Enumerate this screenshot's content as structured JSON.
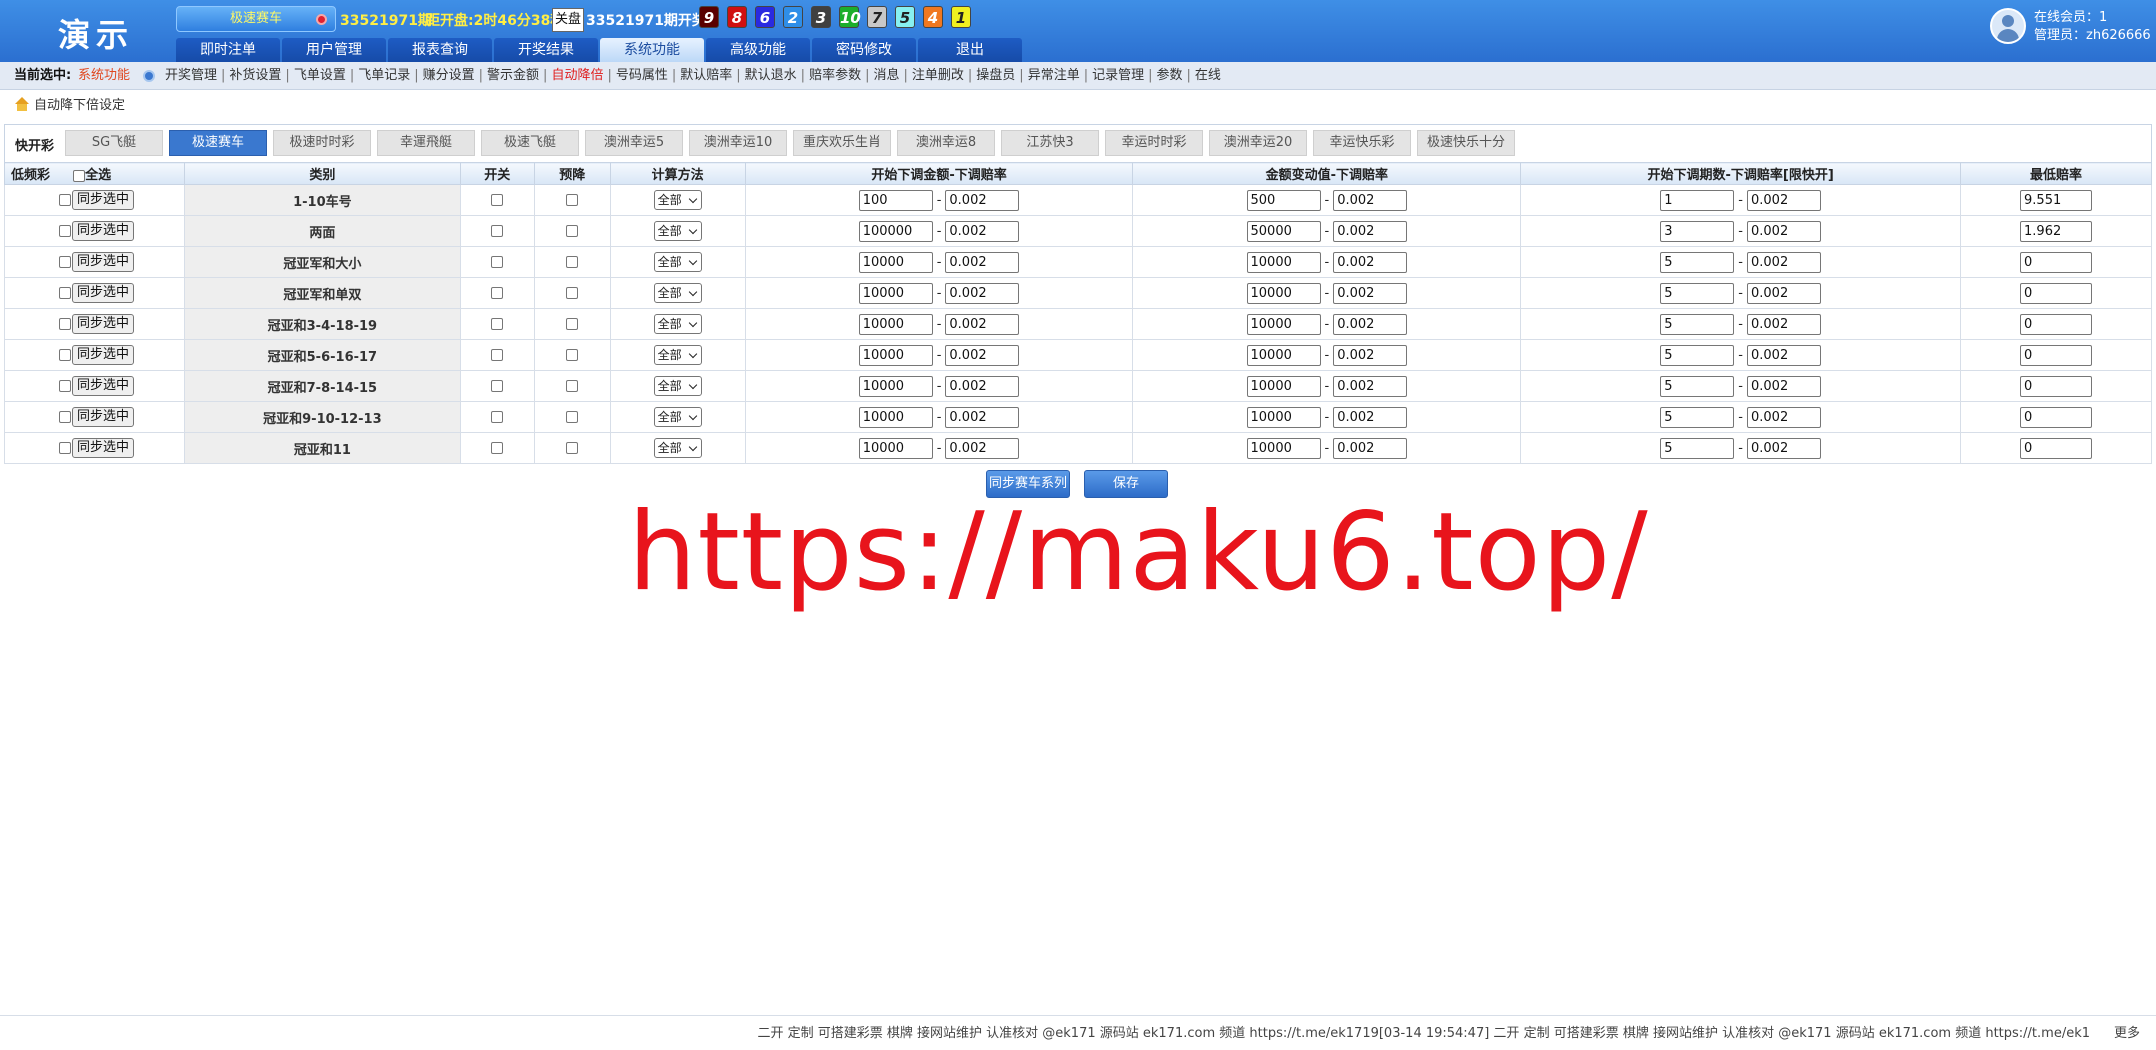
{
  "header": {
    "logo": "演示",
    "game_name": "极速赛车",
    "period_current": "33521971期",
    "countdown_label": "距开盘:2时46分38秒",
    "close_button": "关盘",
    "period_result": "33521971期开奖:",
    "balls": [
      {
        "n": "9",
        "color": "#5a0000"
      },
      {
        "n": "8",
        "color": "#d01010"
      },
      {
        "n": "6",
        "color": "#2a2ae0"
      },
      {
        "n": "2",
        "color": "#2f8ee8"
      },
      {
        "n": "3",
        "color": "#404040"
      },
      {
        "n": "10",
        "color": "#1cae2c"
      },
      {
        "n": "7",
        "color": "#c8c8c8"
      },
      {
        "n": "5",
        "color": "#88f0f0"
      },
      {
        "n": "4",
        "color": "#f07820"
      },
      {
        "n": "1",
        "color": "#f0f020"
      }
    ],
    "nav": [
      "即时注单",
      "用户管理",
      "报表查询",
      "开奖结果",
      "系统功能",
      "高级功能",
      "密码修改",
      "退出"
    ],
    "nav_active": 4,
    "online_label": "在线会员：1",
    "admin_label": "管理员：zh626666"
  },
  "submenu": {
    "current_label": "当前选中:",
    "current_value": "系统功能",
    "links": [
      {
        "t": "开奖管理",
        "hot": false
      },
      {
        "t": "补货设置",
        "hot": false
      },
      {
        "t": "飞单设置",
        "hot": false
      },
      {
        "t": "飞单记录",
        "hot": false
      },
      {
        "t": "赚分设置",
        "hot": false
      },
      {
        "t": "警示金额",
        "hot": false
      },
      {
        "t": "自动降倍",
        "hot": true
      },
      {
        "t": "号码属性",
        "hot": false
      },
      {
        "t": "默认赔率",
        "hot": false
      },
      {
        "t": "默认退水",
        "hot": false
      },
      {
        "t": "赔率参数",
        "hot": false
      },
      {
        "t": "消息",
        "hot": false
      },
      {
        "t": "注单删改",
        "hot": false
      },
      {
        "t": "操盘员",
        "hot": false
      },
      {
        "t": "异常注单",
        "hot": false
      },
      {
        "t": "记录管理",
        "hot": false
      },
      {
        "t": "参数",
        "hot": false
      },
      {
        "t": "在线",
        "hot": false
      }
    ]
  },
  "breadcrumb": "自动降下倍设定",
  "lottery": {
    "label": "快开彩",
    "tabs": [
      "SG飞艇",
      "极速赛车",
      "极速时时彩",
      "幸運飛艇",
      "极速飞艇",
      "澳洲幸运5",
      "澳洲幸运10",
      "重庆欢乐生肖",
      "澳洲幸运8",
      "江苏快3",
      "幸运时时彩",
      "澳洲幸运20",
      "幸运快乐彩",
      "极速快乐十分"
    ],
    "active": 1
  },
  "table": {
    "headers": [
      "低频彩",
      "全选",
      "类别",
      "开关",
      "预降",
      "计算方法",
      "开始下调金额-下调赔率",
      "金额变动值-下调赔率",
      "开始下调期数-下调赔率[限快开]",
      "最低赔率"
    ],
    "sync_label": "同步选中",
    "method_label": "全部",
    "rows": [
      {
        "cat": "1-10车号",
        "a1": "100",
        "a2": "0.002",
        "b1": "500",
        "b2": "0.002",
        "c1": "1",
        "c2": "0.002",
        "min": "9.551"
      },
      {
        "cat": "两面",
        "a1": "100000",
        "a2": "0.002",
        "b1": "50000",
        "b2": "0.002",
        "c1": "3",
        "c2": "0.002",
        "min": "1.962"
      },
      {
        "cat": "冠亚军和大小",
        "a1": "10000",
        "a2": "0.002",
        "b1": "10000",
        "b2": "0.002",
        "c1": "5",
        "c2": "0.002",
        "min": "0"
      },
      {
        "cat": "冠亚军和单双",
        "a1": "10000",
        "a2": "0.002",
        "b1": "10000",
        "b2": "0.002",
        "c1": "5",
        "c2": "0.002",
        "min": "0"
      },
      {
        "cat": "冠亚和3-4-18-19",
        "a1": "10000",
        "a2": "0.002",
        "b1": "10000",
        "b2": "0.002",
        "c1": "5",
        "c2": "0.002",
        "min": "0"
      },
      {
        "cat": "冠亚和5-6-16-17",
        "a1": "10000",
        "a2": "0.002",
        "b1": "10000",
        "b2": "0.002",
        "c1": "5",
        "c2": "0.002",
        "min": "0"
      },
      {
        "cat": "冠亚和7-8-14-15",
        "a1": "10000",
        "a2": "0.002",
        "b1": "10000",
        "b2": "0.002",
        "c1": "5",
        "c2": "0.002",
        "min": "0"
      },
      {
        "cat": "冠亚和9-10-12-13",
        "a1": "10000",
        "a2": "0.002",
        "b1": "10000",
        "b2": "0.002",
        "c1": "5",
        "c2": "0.002",
        "min": "0"
      },
      {
        "cat": "冠亚和11",
        "a1": "10000",
        "a2": "0.002",
        "b1": "10000",
        "b2": "0.002",
        "c1": "5",
        "c2": "0.002",
        "min": "0"
      }
    ]
  },
  "buttons": {
    "sync_series": "同步赛车系列",
    "save": "保存"
  },
  "watermark": "https://maku6.top/",
  "footer": {
    "text": "二开 定制 可搭建彩票 棋牌 接网站维护 认准核对 @ek171 源码站 ek171.com 频道 https://t.me/ek1719[03-14 19:54:47] 二开 定制 可搭建彩票 棋牌 接网站维护 认准核对 @ek171 源码站 ek171.com 频道 https://t.me/ek1",
    "more": "更多"
  }
}
